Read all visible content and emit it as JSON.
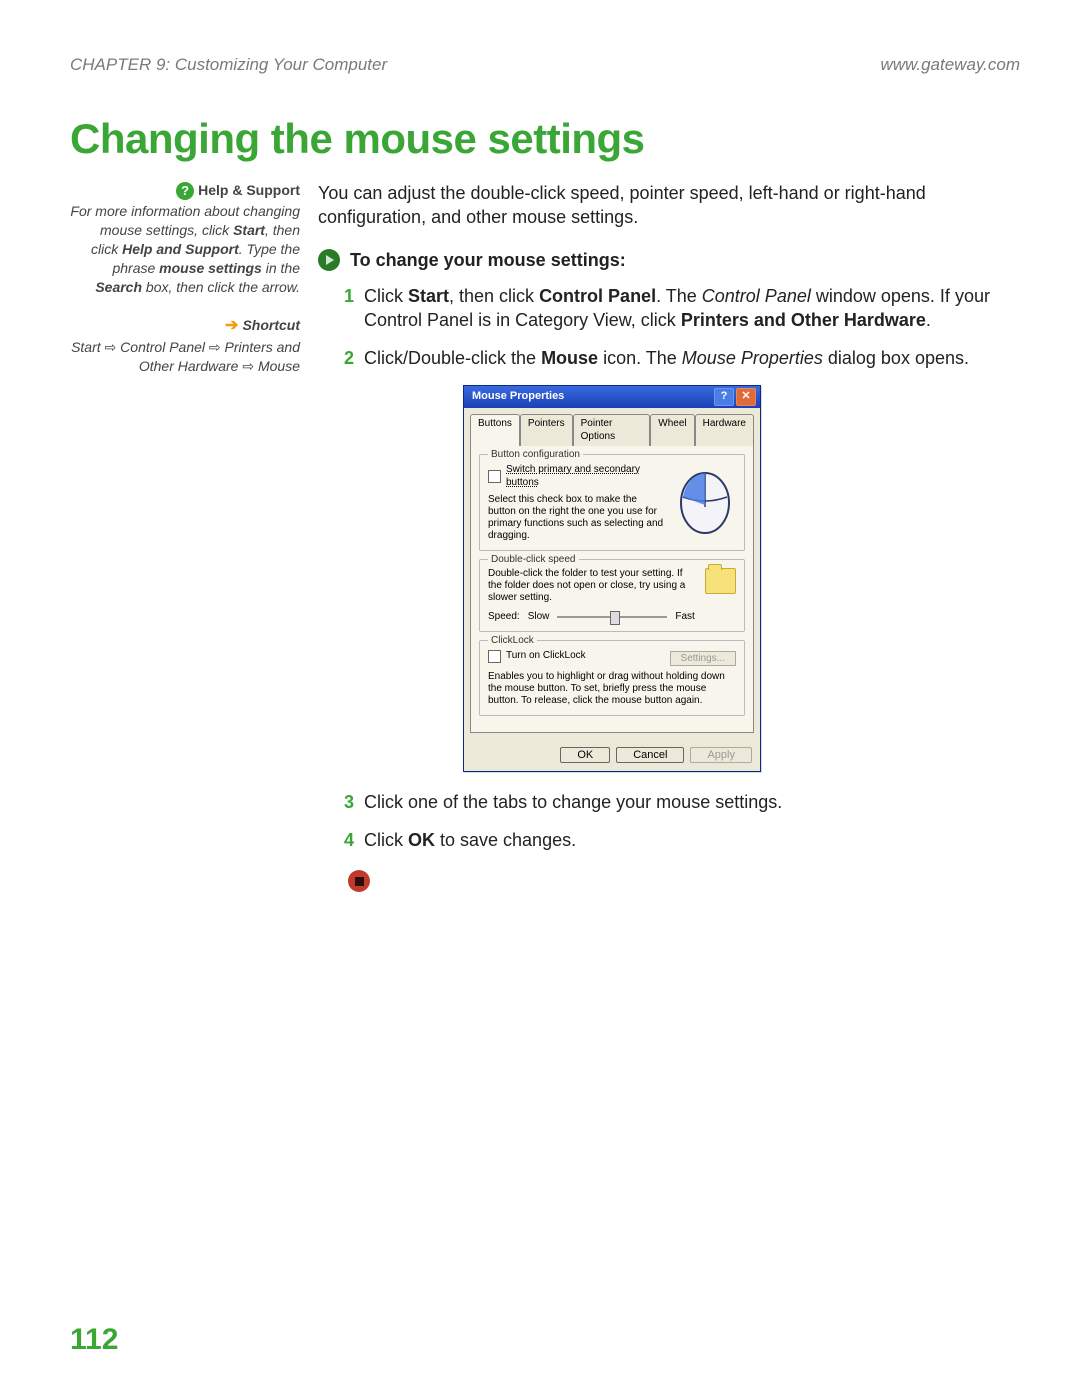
{
  "header": {
    "chapter": "CHAPTER 9: Customizing Your Computer",
    "site": "www.gateway.com"
  },
  "title": "Changing the mouse settings",
  "sidebar": {
    "help": {
      "heading": "Help & Support",
      "body_pre": "For more information about changing mouse settings, click ",
      "start": "Start",
      "body_mid1": ", then click ",
      "hs": "Help and Support",
      "body_mid2": ". Type the phrase ",
      "phrase": "mouse settings",
      "body_mid3": " in the ",
      "search": "Search",
      "body_post": " box, then click the arrow."
    },
    "shortcut": {
      "heading": "Shortcut",
      "p1": "Start",
      "p2": "Control Panel",
      "p3": "Printers and Other Hardware",
      "p4": "Mouse",
      "sep": "⇨"
    }
  },
  "main": {
    "intro": "You can adjust the double-click speed, pointer speed, left-hand or right-hand configuration, and other mouse settings.",
    "subhead": "To change your mouse settings:",
    "steps": {
      "s1": {
        "num": "1",
        "pre": "Click ",
        "start": "Start",
        "mid1": ", then click ",
        "cp": "Control Panel",
        "mid2": ". The ",
        "cpi": "Control Panel",
        "mid3": " window opens. If your Control Panel is in Category View, click ",
        "poh": "Printers and Other Hardware",
        "end": "."
      },
      "s2": {
        "num": "2",
        "pre": "Click/Double-click the ",
        "mouse": "Mouse",
        "mid1": " icon. The ",
        "mpi": "Mouse Properties",
        "end": " dialog box opens."
      },
      "s3": {
        "num": "3",
        "text": "Click one of the tabs to change your mouse settings."
      },
      "s4": {
        "num": "4",
        "pre": "Click ",
        "ok": "OK",
        "end": " to save changes."
      }
    }
  },
  "dialog": {
    "title": "Mouse Properties",
    "tabs": [
      "Buttons",
      "Pointers",
      "Pointer Options",
      "Wheel",
      "Hardware"
    ],
    "groups": {
      "cfg": {
        "title": "Button configuration",
        "check": "Switch primary and secondary buttons",
        "desc": "Select this check box to make the button on the right the one you use for primary functions such as selecting and dragging."
      },
      "dbl": {
        "title": "Double-click speed",
        "desc": "Double-click the folder to test your setting. If the folder does not open or close, try using a slower setting.",
        "speed_label": "Speed:",
        "slow": "Slow",
        "fast": "Fast"
      },
      "clk": {
        "title": "ClickLock",
        "check": "Turn on ClickLock",
        "settings": "Settings...",
        "desc": "Enables you to highlight or drag without holding down the mouse button. To set, briefly press the mouse button. To release, click the mouse button again."
      }
    },
    "actions": {
      "ok": "OK",
      "cancel": "Cancel",
      "apply": "Apply"
    }
  },
  "pagenum": "112"
}
